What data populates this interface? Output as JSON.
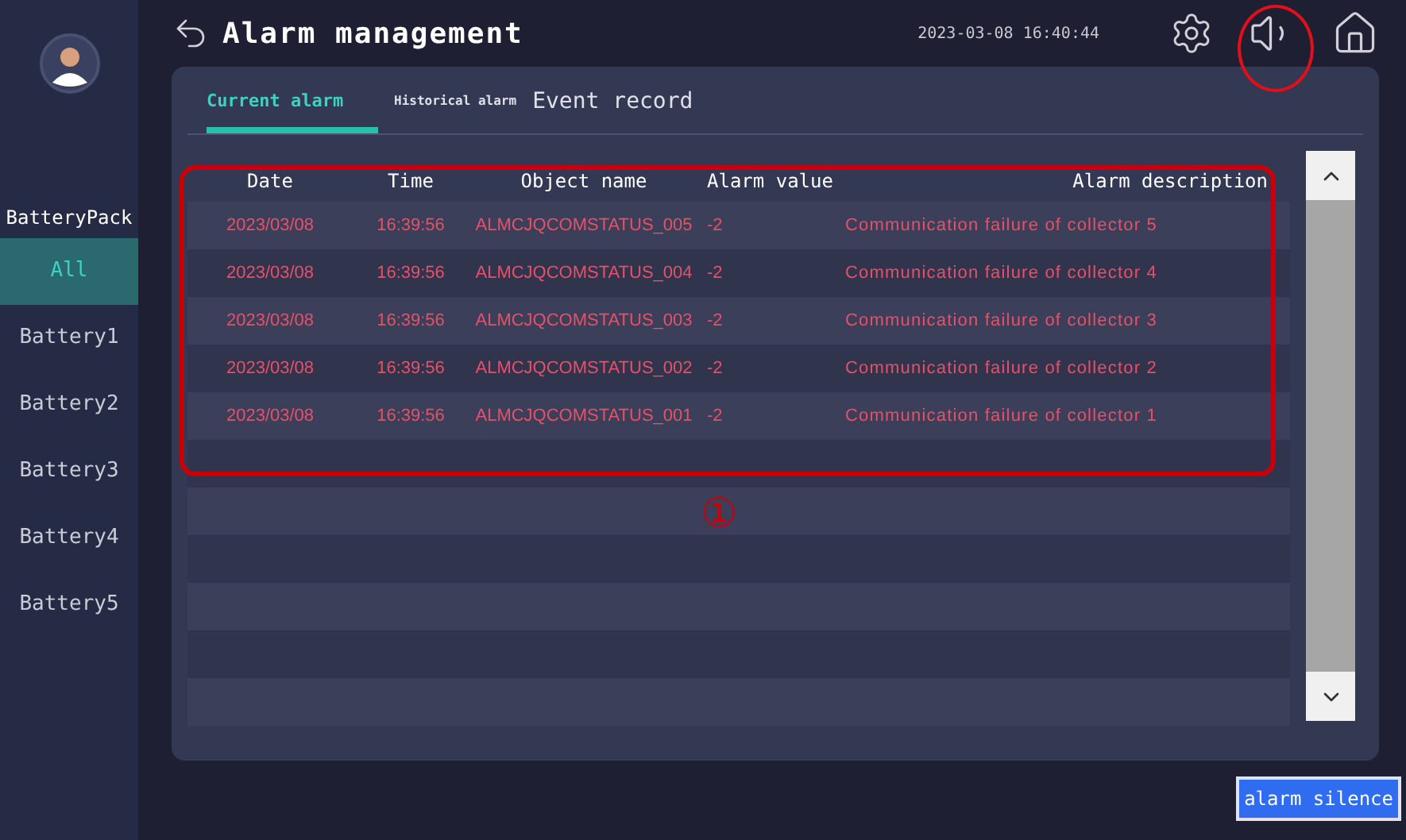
{
  "header": {
    "title": "Alarm management",
    "datetime": "2023-03-08 16:40:44"
  },
  "sidebar": {
    "heading": "BatteryPack",
    "items": [
      {
        "label": "All",
        "selected": true
      },
      {
        "label": "Battery1",
        "selected": false
      },
      {
        "label": "Battery2",
        "selected": false
      },
      {
        "label": "Battery3",
        "selected": false
      },
      {
        "label": "Battery4",
        "selected": false
      },
      {
        "label": "Battery5",
        "selected": false
      }
    ]
  },
  "tabs": [
    {
      "label": "Current alarm",
      "selected": true
    },
    {
      "label": "Historical alarm",
      "selected": false
    },
    {
      "label": "Event record",
      "selected": false
    }
  ],
  "table": {
    "columns": [
      "Date",
      "Time",
      "Object name",
      "Alarm value",
      "Alarm description"
    ],
    "rows": [
      [
        "2023/03/08",
        "16:39:56",
        "ALMCJQCOMSTATUS_005",
        "-2",
        "Communication failure of collector 5"
      ],
      [
        "2023/03/08",
        "16:39:56",
        "ALMCJQCOMSTATUS_004",
        "-2",
        "Communication failure of collector 4"
      ],
      [
        "2023/03/08",
        "16:39:56",
        "ALMCJQCOMSTATUS_003",
        "-2",
        "Communication failure of collector 3"
      ],
      [
        "2023/03/08",
        "16:39:56",
        "ALMCJQCOMSTATUS_002",
        "-2",
        "Communication failure of collector 2"
      ],
      [
        "2023/03/08",
        "16:39:56",
        "ALMCJQCOMSTATUS_001",
        "-2",
        "Communication failure of collector 1"
      ]
    ]
  },
  "annotation": {
    "marker": "①"
  },
  "buttons": [
    "alarm silence"
  ]
}
